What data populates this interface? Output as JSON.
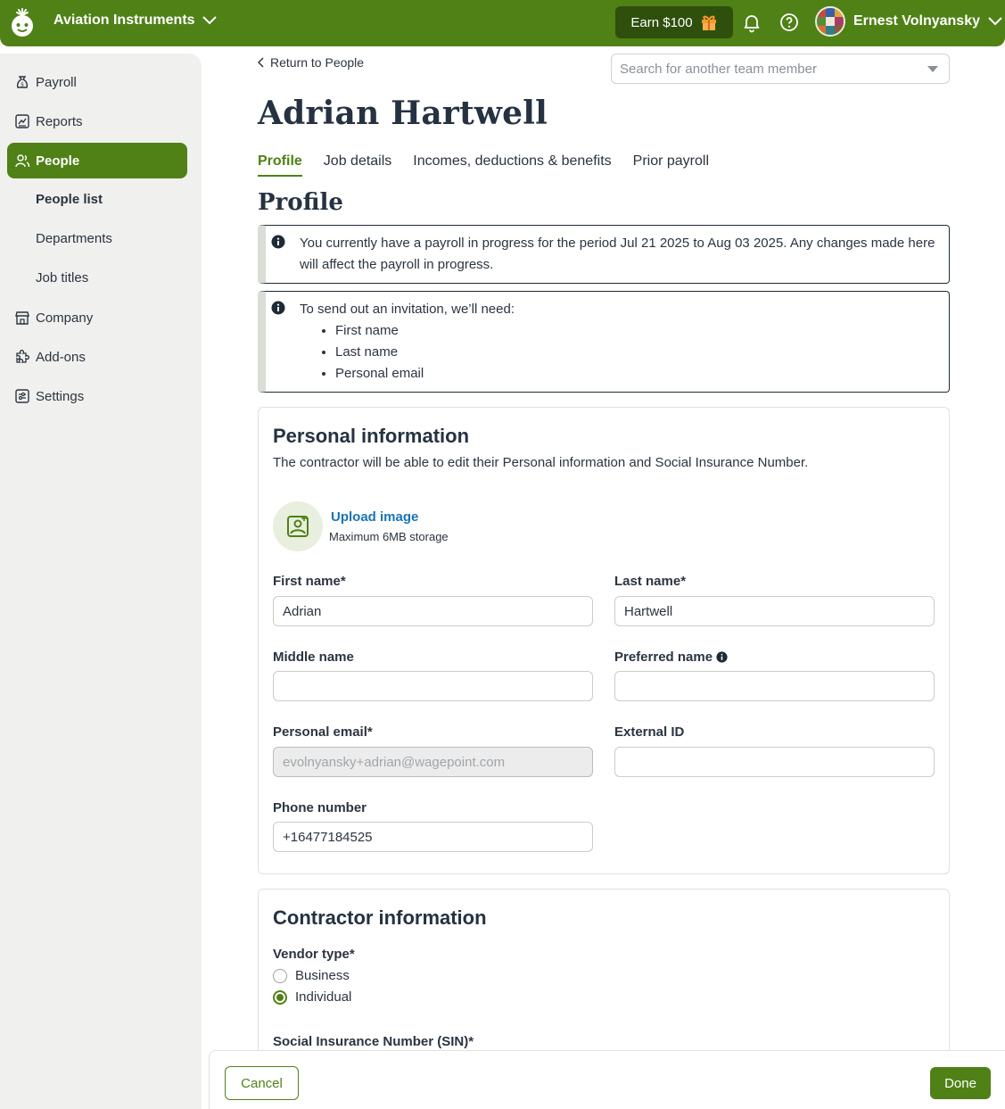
{
  "topbar": {
    "company_name": "Aviation Instruments",
    "earn_label": "Earn $100",
    "user_name": "Ernest Volnyansky"
  },
  "sidebar": {
    "items": [
      {
        "label": "Payroll",
        "icon": "payroll-icon"
      },
      {
        "label": "Reports",
        "icon": "reports-icon"
      },
      {
        "label": "People",
        "icon": "people-icon",
        "active": true
      },
      {
        "label": "Company",
        "icon": "company-icon"
      },
      {
        "label": "Add-ons",
        "icon": "puzzle-icon"
      },
      {
        "label": "Settings",
        "icon": "settings-icon"
      }
    ],
    "subitems": [
      {
        "label": "People list",
        "active": true
      },
      {
        "label": "Departments"
      },
      {
        "label": "Job titles"
      }
    ]
  },
  "header": {
    "back_label": "Return to People",
    "search_placeholder": "Search for another team member",
    "title": "Adrian Hartwell",
    "tabs": [
      {
        "label": "Profile",
        "active": true
      },
      {
        "label": "Job details"
      },
      {
        "label": "Incomes, deductions & benefits"
      },
      {
        "label": "Prior payroll"
      }
    ],
    "section_title": "Profile"
  },
  "notices": {
    "payroll": "You currently have a payroll in progress for the period Jul 21 2025 to Aug 03 2025. Any changes made here will affect the payroll in progress.",
    "invite_intro": "To send out an invitation, we’ll need:",
    "invite_items": [
      "First name",
      "Last name",
      "Personal email"
    ]
  },
  "personal": {
    "title": "Personal information",
    "description": "The contractor will be able to edit their Personal information and Social Insurance Number.",
    "upload_label": "Upload image",
    "upload_note": "Maximum 6MB storage",
    "first_name_label": "First name*",
    "first_name": "Adrian",
    "last_name_label": "Last name*",
    "last_name": "Hartwell",
    "middle_name_label": "Middle name",
    "middle_name": "",
    "preferred_name_label": "Preferred name",
    "preferred_name": "",
    "email_label": "Personal email*",
    "email": "evolnyansky+adrian@wagepoint.com",
    "external_id_label": "External ID",
    "external_id": "",
    "phone_label": "Phone number",
    "phone": "+16477184525"
  },
  "contractor": {
    "title": "Contractor information",
    "vendor_type_label": "Vendor type*",
    "options": [
      {
        "label": "Business",
        "selected": false
      },
      {
        "label": "Individual",
        "selected": true
      }
    ],
    "sin_label": "Social Insurance Number (SIN)*"
  },
  "footer": {
    "cancel_label": "Cancel",
    "done_label": "Done"
  },
  "colors": {
    "brand": "#4f8116",
    "brand_dark": "#2f4f0d",
    "link": "#1a74b5"
  }
}
